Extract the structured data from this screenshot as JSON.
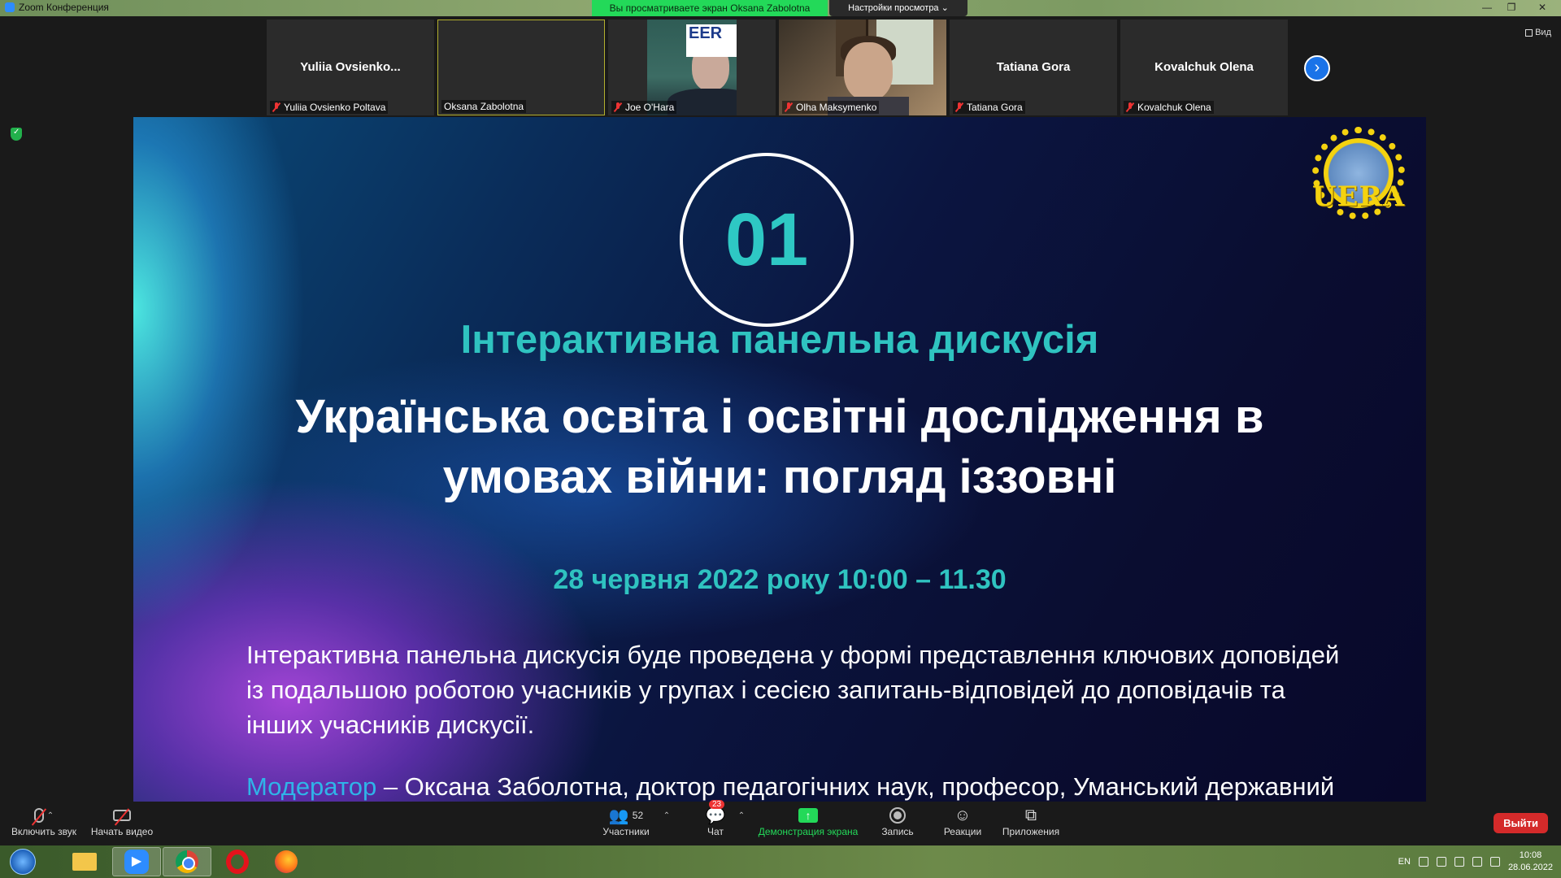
{
  "window": {
    "title": "Zoom Конференция",
    "share_banner": "Вы просматриваете экран Oksana Zabolotna",
    "view_options": "Настройки просмотра ⌄",
    "controls": [
      "—",
      "❐",
      "✕"
    ]
  },
  "gallery": {
    "participants": [
      {
        "big_name": "Yuliia  Ovsienko...",
        "label": "Yuliia Ovsienko Poltava",
        "muted": true
      },
      {
        "big_name": "",
        "label": "Oksana Zabolotna",
        "muted": false,
        "active": true
      },
      {
        "big_name": "",
        "label": "Joe O'Hara",
        "muted": true,
        "video": true
      },
      {
        "big_name": "",
        "label": "Olha Maksymenko",
        "muted": true,
        "video": true
      },
      {
        "big_name": "Tatiana Gora",
        "label": "Tatiana Gora",
        "muted": true
      },
      {
        "big_name": "Kovalchuk Olena",
        "label": "Kovalchuk Olena",
        "muted": true
      }
    ],
    "joe_logo": "EER",
    "next_icon": "chevron-right-icon",
    "view_label": "Вид"
  },
  "slide": {
    "number": "01",
    "logo_text": "UERA",
    "subtitle": "Інтерактивна панельна дискусія",
    "title_line1": "Українська освіта і освітні дослідження в",
    "title_line2": "умовах війни: погляд іззовні",
    "date": "28 червня 2022 року 10:00 – 11.30",
    "description": "Інтерактивна панельна дискусія буде проведена у формі представлення ключових доповідей із подальшою роботою учасників у групах і сесією запитань-відповідей до доповідачів та інших учасників дискусії.",
    "moderator_label": "Модератор",
    "moderator_text": " – Оксана Заболотна, доктор педагогічних наук, професор, Уманський державний",
    "colors": {
      "accent": "#2fc3c0",
      "moderator": "#2fb4e8",
      "logo": "#f4d20f"
    }
  },
  "toolbar": {
    "audio": "Включить звук",
    "video": "Начать видео",
    "participants": "Участники",
    "participants_count": "52",
    "chat": "Чат",
    "chat_badge": "23",
    "share": "Демонстрация экрана",
    "record": "Запись",
    "reactions": "Реакции",
    "apps": "Приложения",
    "leave": "Выйти"
  },
  "taskbar": {
    "lang": "EN",
    "time": "10:08",
    "date": "28.06.2022"
  }
}
